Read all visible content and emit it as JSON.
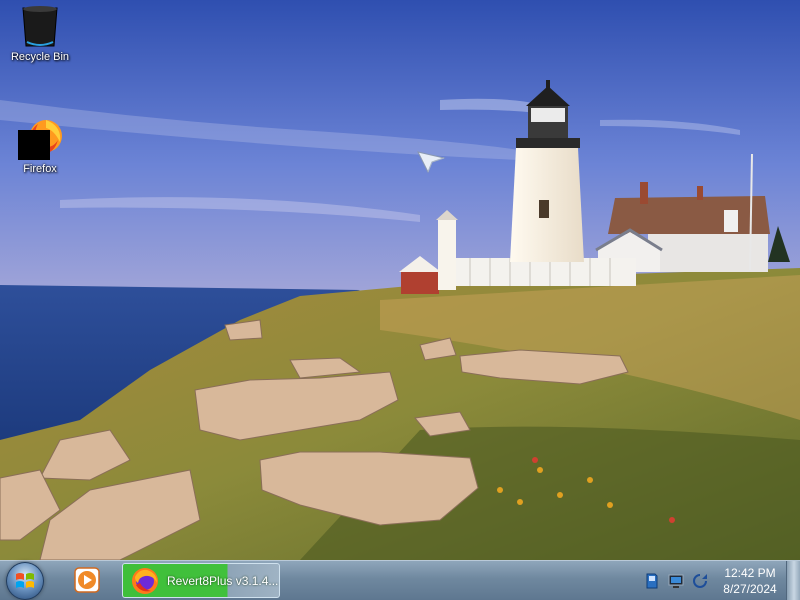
{
  "desktop": {
    "icons": [
      {
        "label": "Recycle Bin",
        "icon": "recycle-bin-icon"
      },
      {
        "label": "Firefox",
        "icon": "firefox-icon"
      }
    ]
  },
  "taskbar": {
    "start_icon": "windows-start-icon",
    "pinned": [
      {
        "icon": "media-player-icon"
      }
    ],
    "tasks": [
      {
        "title": "Revert8Plus v3.1.4...",
        "icon": "firefox-icon",
        "active": true
      }
    ],
    "tray": [
      "network-icon",
      "display-icon",
      "sync-icon"
    ],
    "clock": {
      "time": "12:42 PM",
      "date": "8/27/2024"
    }
  }
}
